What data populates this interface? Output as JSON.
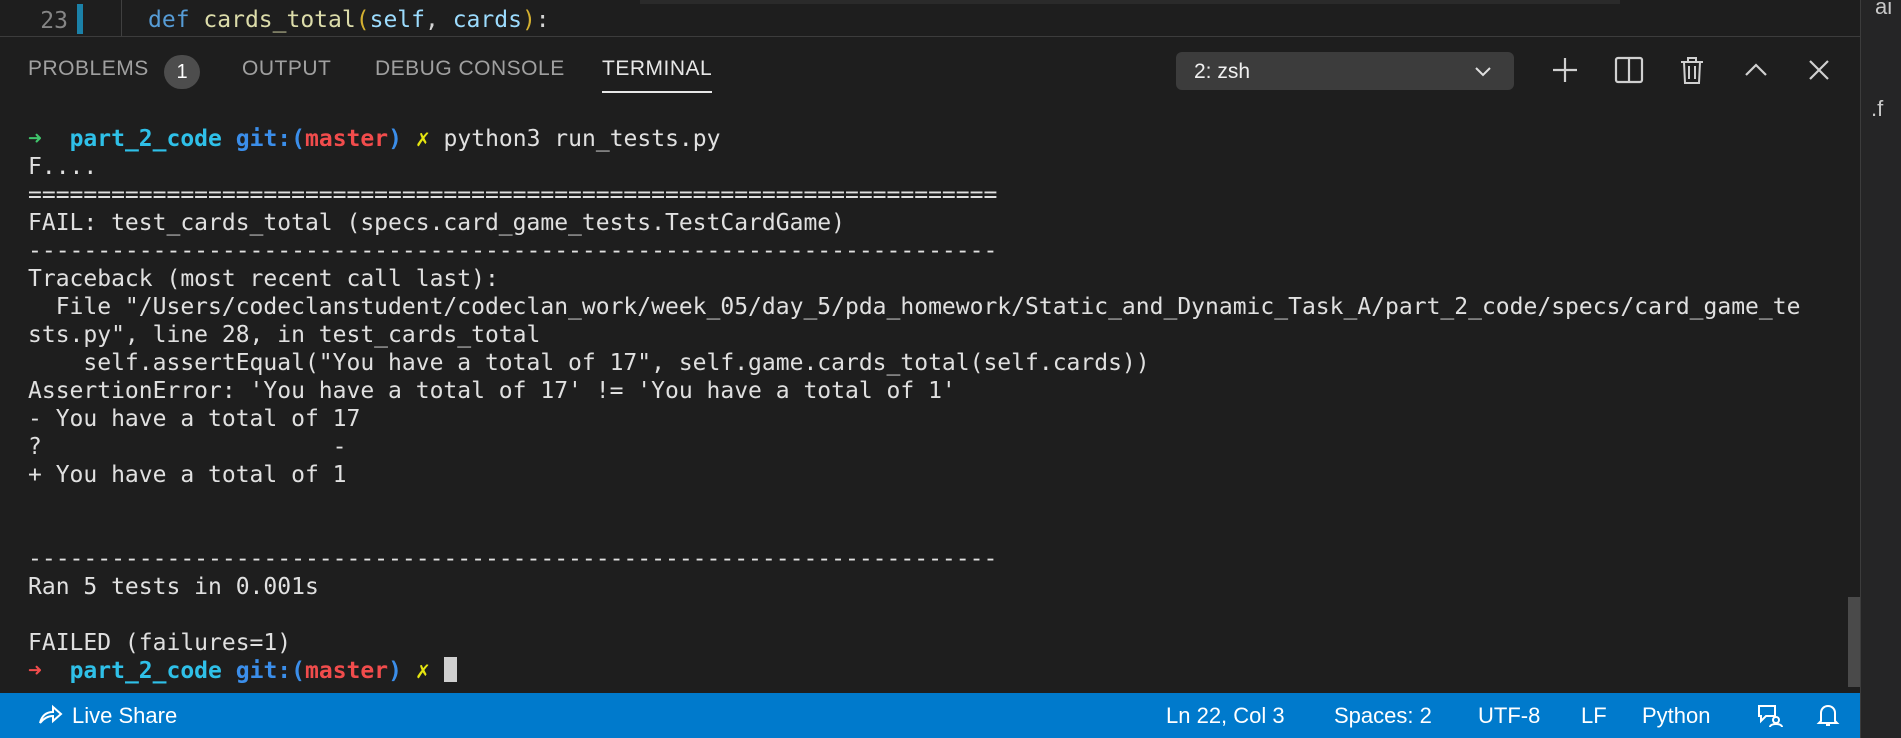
{
  "editor": {
    "line_number": "23",
    "code": {
      "kw": "def",
      "fn": "cards_total",
      "open": "(",
      "self": "self",
      "comma": ", ",
      "param": "cards",
      "close": ")",
      "colon": ":"
    }
  },
  "right_edge": {
    "frag1": "ai",
    "frag2": ".f"
  },
  "panel": {
    "tabs": [
      {
        "label": "PROBLEMS",
        "badge": "1"
      },
      {
        "label": "OUTPUT"
      },
      {
        "label": "DEBUG CONSOLE"
      },
      {
        "label": "TERMINAL",
        "active": true
      }
    ],
    "terminal_select": {
      "value": "2: zsh"
    },
    "toolbar_icons": [
      "plus-icon",
      "split-icon",
      "trash-icon",
      "chevron-up-icon",
      "close-icon"
    ]
  },
  "terminal": {
    "prompt": {
      "arrow": "➜",
      "dir": "part_2_code",
      "git": "git:(",
      "branch": "master",
      "git_close": ")",
      "x": "✗"
    },
    "command": "python3 run_tests.py",
    "lines": [
      "F....",
      "======================================================================",
      "FAIL: test_cards_total (specs.card_game_tests.TestCardGame)",
      "----------------------------------------------------------------------",
      "Traceback (most recent call last):"
    ],
    "file_line": "  File \"/Users/codeclanstudent/codeclan_work/week_05/day_5/pda_homework/Static_and_Dynamic_Task_A/part_2_code/specs/card_game_te\nsts.py\", line 28, in test_cards_total",
    "lines2": [
      "    self.assertEqual(\"You have a total of 17\", self.game.cards_total(self.cards))",
      "AssertionError: 'You have a total of 17' != 'You have a total of 1'",
      "- You have a total of 17",
      "?                     -",
      "+ You have a total of 1",
      "",
      "",
      "----------------------------------------------------------------------",
      "Ran 5 tests in 0.001s",
      "",
      "FAILED (failures=1)"
    ]
  },
  "statusbar": {
    "live_share": "Live Share",
    "position": "Ln 22, Col 3",
    "spaces": "Spaces: 2",
    "encoding": "UTF-8",
    "eol": "LF",
    "language": "Python"
  }
}
